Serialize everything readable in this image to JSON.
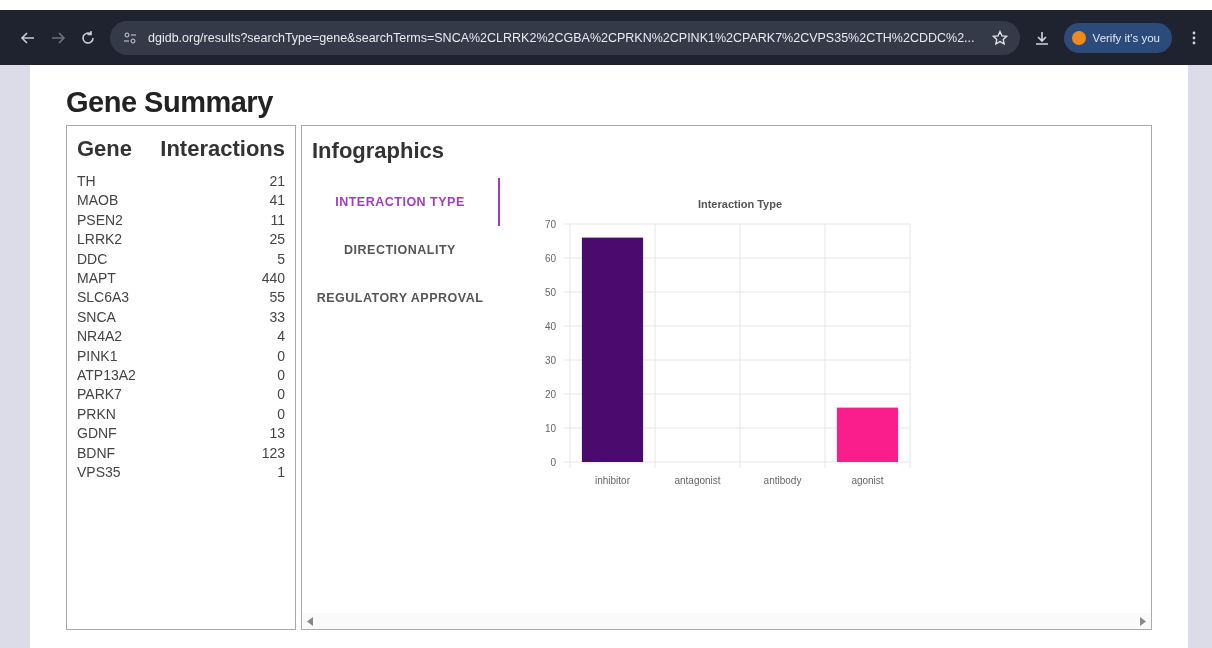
{
  "browser": {
    "url": "dgidb.org/results?searchType=gene&searchTerms=SNCA%2CLRRK2%2CGBA%2CPRKN%2CPINK1%2CPARK7%2CVPS35%2CTH%2CDDC%2...",
    "profile_button": "Verify it's you"
  },
  "page": {
    "title": "Gene Summary"
  },
  "gene_table": {
    "columns": [
      "Gene",
      "Interactions"
    ],
    "rows": [
      {
        "gene": "TH",
        "interactions": "21"
      },
      {
        "gene": "MAOB",
        "interactions": "41"
      },
      {
        "gene": "PSEN2",
        "interactions": "11"
      },
      {
        "gene": "LRRK2",
        "interactions": "25"
      },
      {
        "gene": "DDC",
        "interactions": "5"
      },
      {
        "gene": "MAPT",
        "interactions": "440"
      },
      {
        "gene": "SLC6A3",
        "interactions": "55"
      },
      {
        "gene": "SNCA",
        "interactions": "33"
      },
      {
        "gene": "NR4A2",
        "interactions": "4"
      },
      {
        "gene": "PINK1",
        "interactions": "0"
      },
      {
        "gene": "ATP13A2",
        "interactions": "0"
      },
      {
        "gene": "PARK7",
        "interactions": "0"
      },
      {
        "gene": "PRKN",
        "interactions": "0"
      },
      {
        "gene": "GDNF",
        "interactions": "13"
      },
      {
        "gene": "BDNF",
        "interactions": "123"
      },
      {
        "gene": "VPS35",
        "interactions": "1"
      }
    ]
  },
  "infographics": {
    "title": "Infographics",
    "tabs": [
      {
        "label": "INTERACTION TYPE",
        "selected": true
      },
      {
        "label": "DIRECTIONALITY",
        "selected": false
      },
      {
        "label": "REGULATORY APPROVAL",
        "selected": false
      }
    ],
    "chart_data": {
      "type": "bar",
      "title": "Interaction Type",
      "categories": [
        "inhibitor",
        "antagonist",
        "antibody",
        "agonist"
      ],
      "values": [
        66,
        0,
        0,
        16
      ],
      "colors": [
        "#4a0a6e",
        null,
        null,
        "#f91e8c"
      ],
      "ylim": [
        0,
        70
      ],
      "yticks": [
        0,
        10,
        20,
        30,
        40,
        50,
        60,
        70
      ],
      "grid": true
    }
  }
}
